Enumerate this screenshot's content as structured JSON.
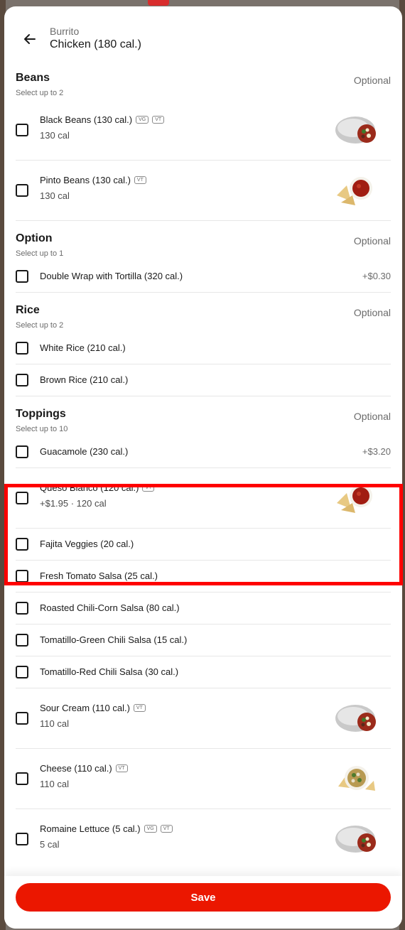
{
  "header": {
    "subtitle": "Burrito",
    "title": "Chicken (180 cal.)"
  },
  "sections": [
    {
      "name": "Beans",
      "hint": "Select up to 2",
      "optional": "Optional",
      "items": [
        {
          "label": "Black Beans (130 cal.)",
          "tags": [
            "VG",
            "VT"
          ],
          "sub": "130 cal",
          "thumb": "burrito"
        },
        {
          "label": "Pinto Beans (130 cal.)",
          "tags": [
            "VT"
          ],
          "sub": "130 cal",
          "thumb": "salsa"
        }
      ]
    },
    {
      "name": "Option",
      "hint": "Select up to 1",
      "optional": "Optional",
      "items": [
        {
          "label": "Double Wrap with Tortilla (320 cal.)",
          "price": "+$0.30"
        }
      ]
    },
    {
      "name": "Rice",
      "hint": "Select up to 2",
      "optional": "Optional",
      "items": [
        {
          "label": "White Rice (210 cal.)"
        },
        {
          "label": "Brown Rice (210 cal.)"
        }
      ]
    },
    {
      "name": "Toppings",
      "hint": "Select up to 10",
      "optional": "Optional",
      "items": [
        {
          "label": "Guacamole (230 cal.)",
          "price": "+$3.20"
        },
        {
          "label": "Queso Blanco (120 cal.)",
          "tags": [
            "VT"
          ],
          "sub": "+$1.95 · 120 cal",
          "thumb": "salsa"
        },
        {
          "label": "Fajita Veggies (20 cal.)"
        },
        {
          "label": "Fresh Tomato Salsa (25 cal.)"
        },
        {
          "label": "Roasted Chili-Corn Salsa (80 cal.)"
        },
        {
          "label": "Tomatillo-Green Chili Salsa (15 cal.)"
        },
        {
          "label": "Tomatillo-Red Chili Salsa (30 cal.)"
        },
        {
          "label": "Sour Cream (110 cal.)",
          "tags": [
            "VT"
          ],
          "sub": "110 cal",
          "thumb": "burrito"
        },
        {
          "label": "Cheese (110 cal.)",
          "tags": [
            "VT"
          ],
          "sub": "110 cal",
          "thumb": "bowl"
        },
        {
          "label": "Romaine Lettuce (5 cal.)",
          "tags": [
            "VG",
            "VT"
          ],
          "sub": "5 cal",
          "thumb": "burrito"
        }
      ]
    }
  ],
  "footer": {
    "save_label": "Save"
  },
  "colors": {
    "primary": "#eb1700",
    "highlight": "#ff0000"
  }
}
